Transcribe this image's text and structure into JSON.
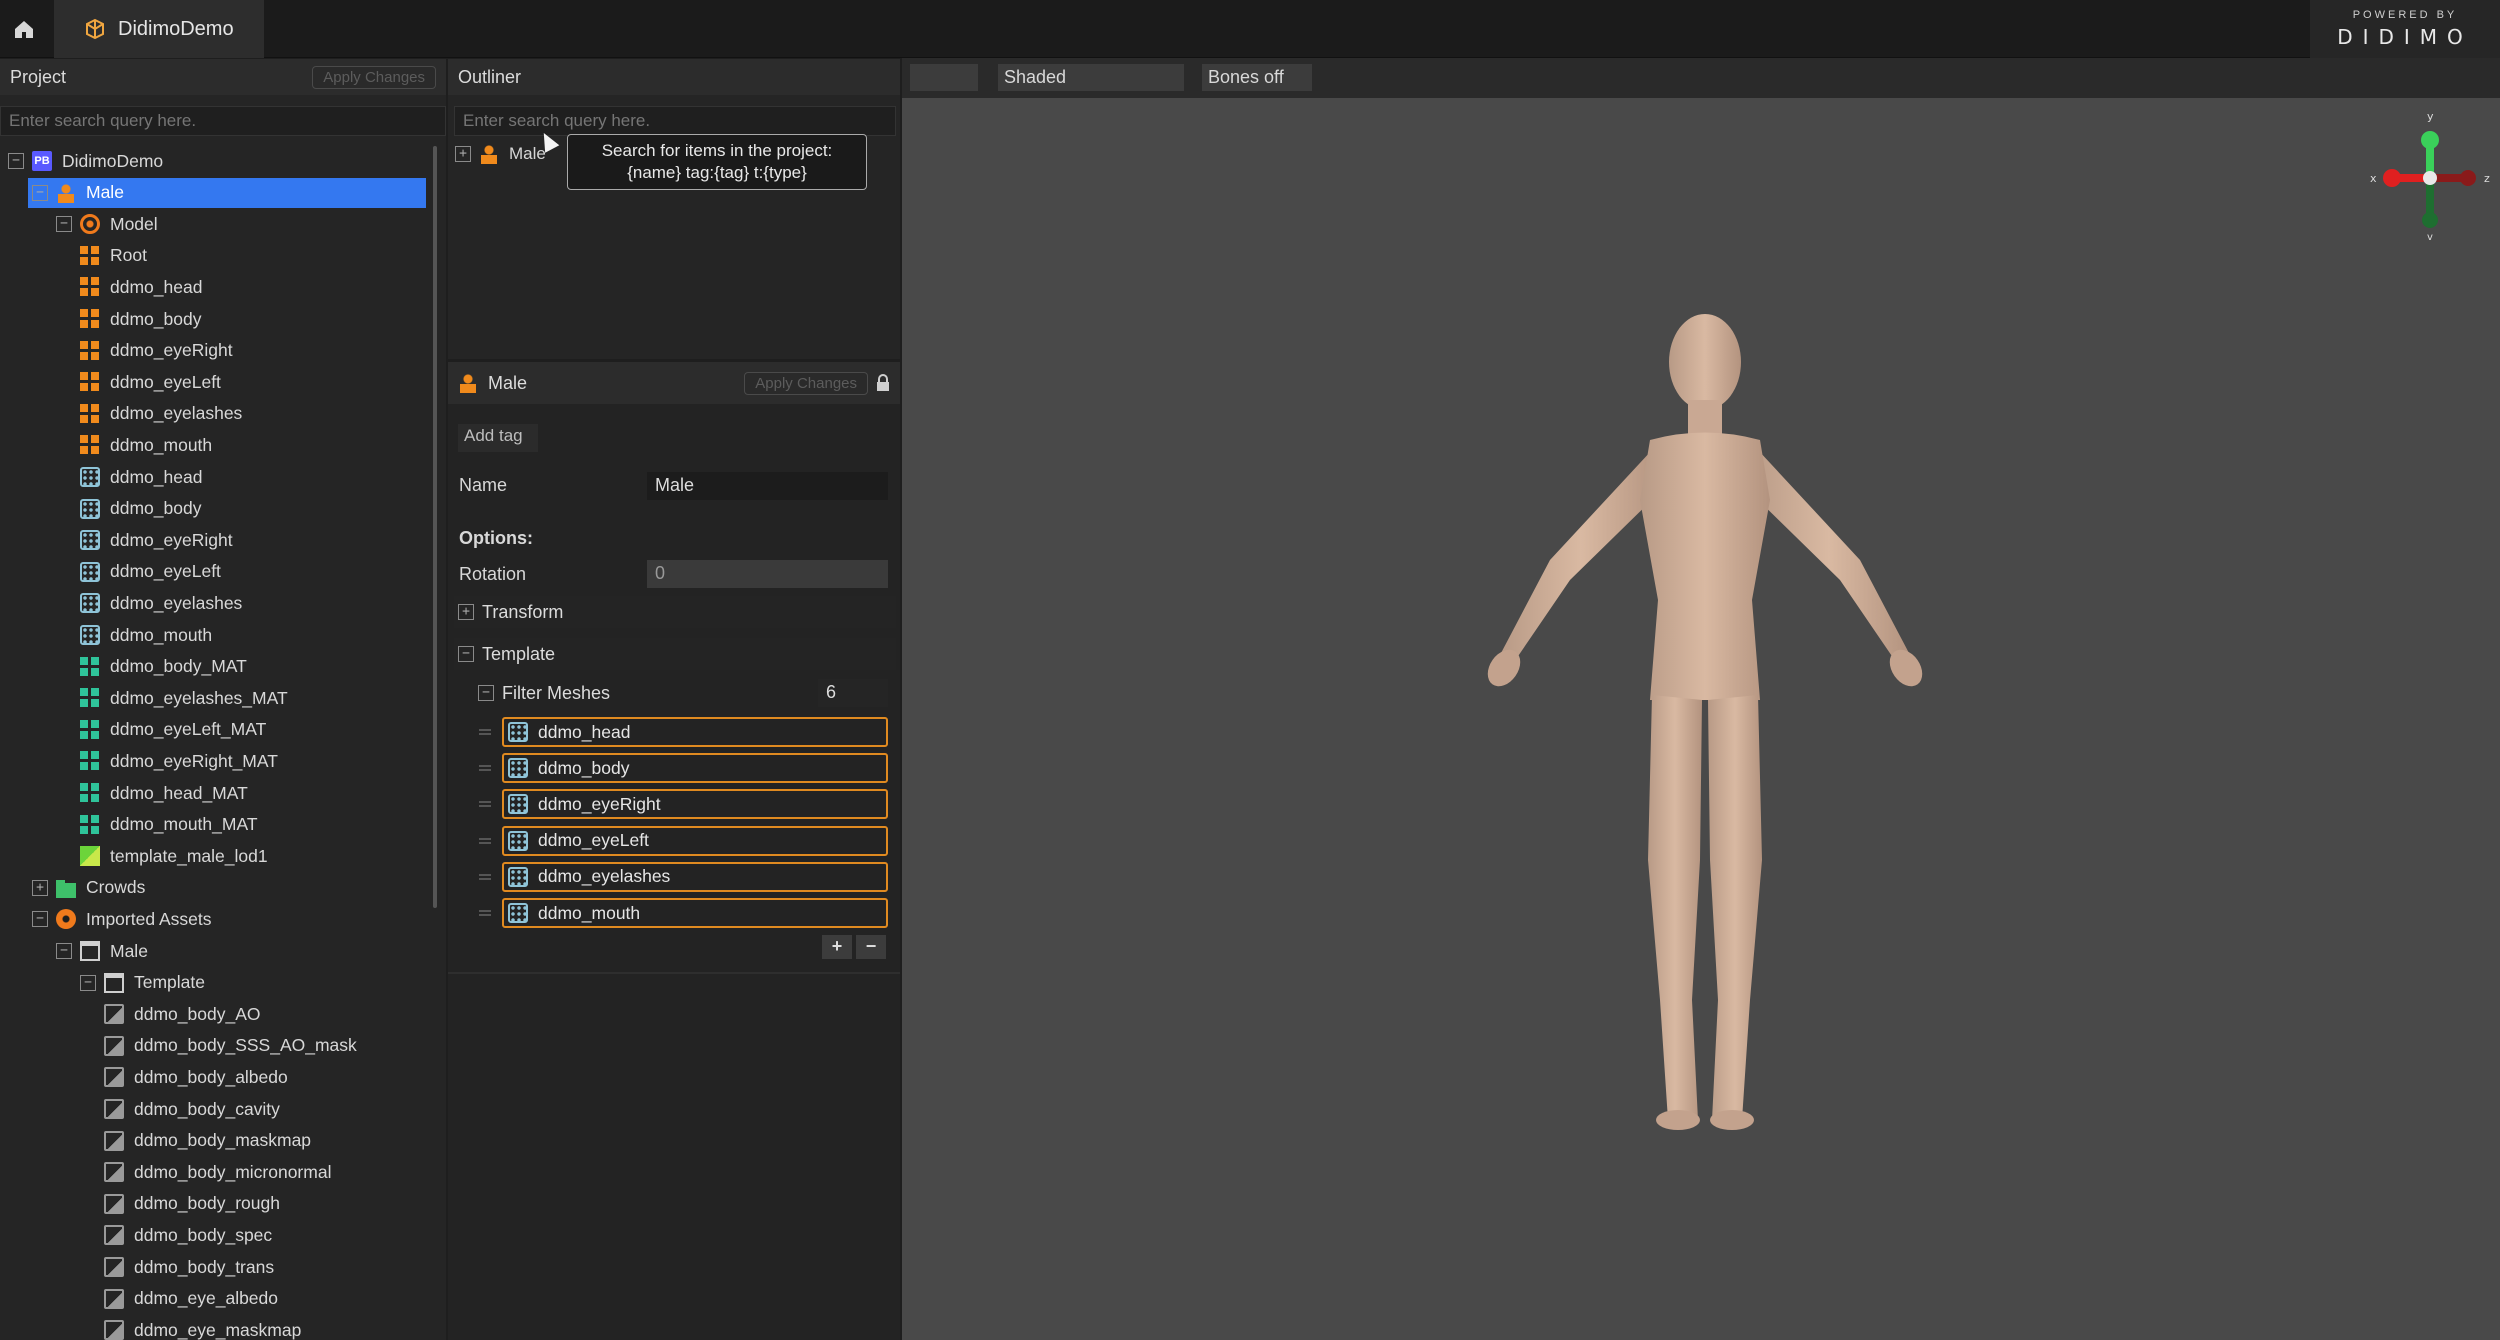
{
  "app": {
    "tab_title": "DidimoDemo",
    "brand_small": "POWERED BY",
    "brand_big": "DIDIMO"
  },
  "project": {
    "title": "Project",
    "apply_label": "Apply Changes",
    "search_placeholder": "Enter search query here.",
    "tree": [
      {
        "label": "DidimoDemo",
        "icon": "project-icon",
        "depth": 0,
        "expander": "−"
      },
      {
        "label": "Male",
        "icon": "person-icon",
        "depth": 1,
        "expander": "−",
        "selected": true
      },
      {
        "label": "Model",
        "icon": "model-icon",
        "depth": 2,
        "expander": "−"
      },
      {
        "label": "Root",
        "icon": "joint-icon",
        "depth": 3
      },
      {
        "label": "ddmo_head",
        "icon": "joint-icon",
        "depth": 3
      },
      {
        "label": "ddmo_body",
        "icon": "joint-icon",
        "depth": 3
      },
      {
        "label": "ddmo_eyeRight",
        "icon": "joint-icon",
        "depth": 3
      },
      {
        "label": "ddmo_eyeLeft",
        "icon": "joint-icon",
        "depth": 3
      },
      {
        "label": "ddmo_eyelashes",
        "icon": "joint-icon",
        "depth": 3
      },
      {
        "label": "ddmo_mouth",
        "icon": "joint-icon",
        "depth": 3
      },
      {
        "label": "ddmo_head",
        "icon": "mesh-icon",
        "depth": 3
      },
      {
        "label": "ddmo_body",
        "icon": "mesh-icon",
        "depth": 3
      },
      {
        "label": "ddmo_eyeRight",
        "icon": "mesh-icon",
        "depth": 3
      },
      {
        "label": "ddmo_eyeLeft",
        "icon": "mesh-icon",
        "depth": 3
      },
      {
        "label": "ddmo_eyelashes",
        "icon": "mesh-icon",
        "depth": 3
      },
      {
        "label": "ddmo_mouth",
        "icon": "mesh-icon",
        "depth": 3
      },
      {
        "label": "ddmo_body_MAT",
        "icon": "material-icon",
        "depth": 3
      },
      {
        "label": "ddmo_eyelashes_MAT",
        "icon": "material-icon",
        "depth": 3
      },
      {
        "label": "ddmo_eyeLeft_MAT",
        "icon": "material-icon",
        "depth": 3
      },
      {
        "label": "ddmo_eyeRight_MAT",
        "icon": "material-icon",
        "depth": 3
      },
      {
        "label": "ddmo_head_MAT",
        "icon": "material-icon",
        "depth": 3
      },
      {
        "label": "ddmo_mouth_MAT",
        "icon": "material-icon",
        "depth": 3
      },
      {
        "label": "template_male_lod1",
        "icon": "lod-icon",
        "depth": 3
      },
      {
        "label": "Crowds",
        "icon": "folder-green-icon",
        "depth": 1,
        "expander": "+"
      },
      {
        "label": "Imported Assets",
        "icon": "imported-icon",
        "depth": 1,
        "expander": "−"
      },
      {
        "label": "Male",
        "icon": "folder-icon",
        "depth": 2,
        "expander": "−"
      },
      {
        "label": "Template",
        "icon": "folder-icon",
        "depth": 3,
        "expander": "−"
      },
      {
        "label": "ddmo_body_AO",
        "icon": "texture-icon",
        "depth": 4
      },
      {
        "label": "ddmo_body_SSS_AO_mask",
        "icon": "texture-icon",
        "depth": 4
      },
      {
        "label": "ddmo_body_albedo",
        "icon": "texture-icon",
        "depth": 4
      },
      {
        "label": "ddmo_body_cavity",
        "icon": "texture-icon",
        "depth": 4
      },
      {
        "label": "ddmo_body_maskmap",
        "icon": "texture-icon",
        "depth": 4
      },
      {
        "label": "ddmo_body_micronormal",
        "icon": "texture-icon",
        "depth": 4
      },
      {
        "label": "ddmo_body_rough",
        "icon": "texture-icon",
        "depth": 4
      },
      {
        "label": "ddmo_body_spec",
        "icon": "texture-icon",
        "depth": 4
      },
      {
        "label": "ddmo_body_trans",
        "icon": "texture-icon",
        "depth": 4
      },
      {
        "label": "ddmo_eye_albedo",
        "icon": "texture-icon",
        "depth": 4
      },
      {
        "label": "ddmo_eye_maskmap",
        "icon": "texture-icon",
        "depth": 4
      }
    ]
  },
  "outliner": {
    "title": "Outliner",
    "search_placeholder": "Enter search query here.",
    "item_label": "Male",
    "tooltip_line1": "Search for items in the project:",
    "tooltip_line2": "{name} tag:{tag} t:{type}"
  },
  "inspector": {
    "title": "Male",
    "apply_label": "Apply Changes",
    "add_tag": "Add tag",
    "name_label": "Name",
    "name_value": "Male",
    "options_label": "Options:",
    "rotation_label": "Rotation",
    "rotation_value": "0",
    "transform_label": "Transform",
    "template_label": "Template",
    "filter_label": "Filter Meshes",
    "filter_count": "6",
    "meshes": [
      "ddmo_head",
      "ddmo_body",
      "ddmo_eyeRight",
      "ddmo_eyeLeft",
      "ddmo_eyelashes",
      "ddmo_mouth"
    ],
    "add_symbol": "+",
    "remove_symbol": "−"
  },
  "viewport": {
    "shading_label": "Shaded",
    "bones_label": "Bones off",
    "gizmo": {
      "x": "x",
      "y": "y",
      "z": "z"
    }
  },
  "colors": {
    "selection": "#3478f0",
    "mesh_outline": "#e08a20",
    "viewport_bg": "#494949"
  }
}
